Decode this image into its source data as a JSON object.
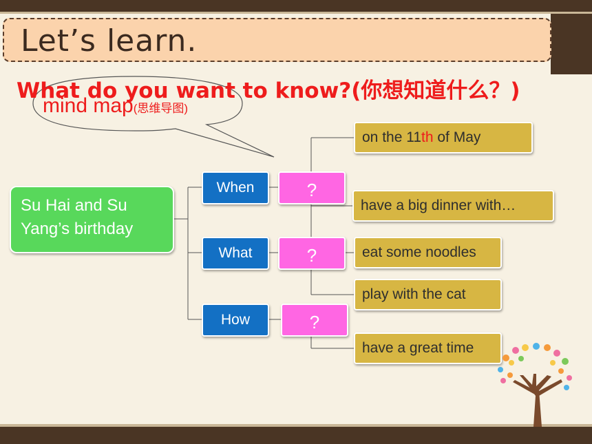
{
  "slide": {
    "title": "Let’s learn.",
    "question": "What do you want to know?(你想知道什么？)",
    "bubble_main": "mind map",
    "bubble_sub": "(思维导图)"
  },
  "mindmap": {
    "root": "Su Hai and Su Yang’s birthday",
    "branches": [
      {
        "label": "When",
        "mark": "?"
      },
      {
        "label": "What",
        "mark": "?"
      },
      {
        "label": "How",
        "mark": "?"
      }
    ],
    "answers": {
      "when_pre": "on the 11",
      "when_sup": "th",
      "when_post": " of May",
      "what_1": "have a big dinner with…",
      "what_2": "eat some noodles",
      "what_3": "play with the cat",
      "how_1": "have a great time"
    }
  },
  "colors": {
    "root": "#58d85b",
    "question_word": "#1370c4",
    "question_mark": "#ff66e3",
    "answer": "#d7b643",
    "heading": "#ee1c1c",
    "frame": "#4a3524"
  },
  "icons": {
    "decoration": "tree-icon"
  }
}
